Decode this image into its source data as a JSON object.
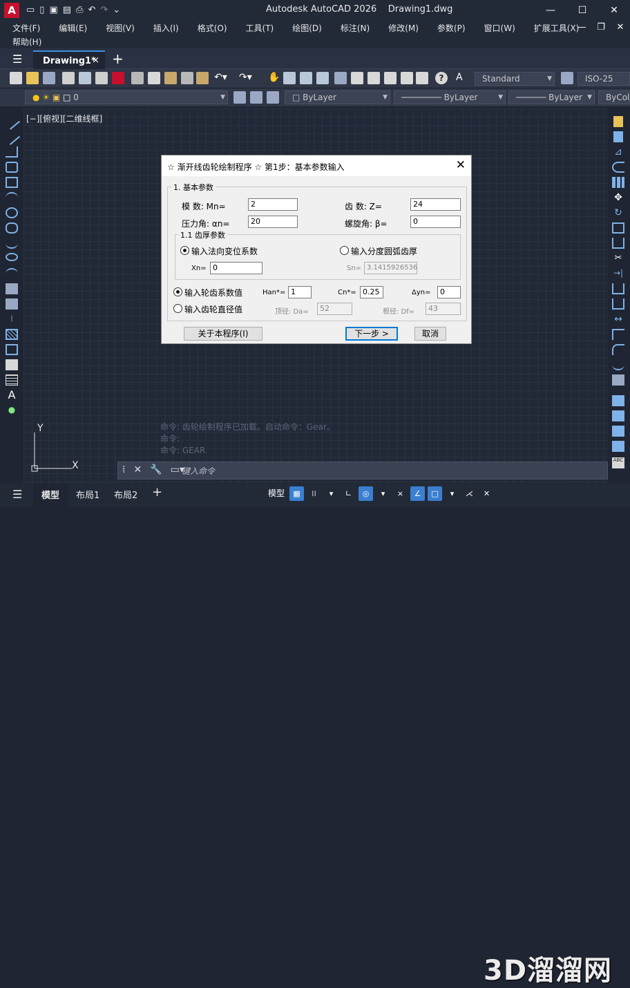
{
  "app": {
    "logo": "A",
    "title": "Autodesk AutoCAD 2026",
    "document": "Drawing1.dwg"
  },
  "menu": [
    "文件(F)",
    "编辑(E)",
    "视图(V)",
    "插入(I)",
    "格式(O)",
    "工具(T)",
    "绘图(D)",
    "标注(N)",
    "修改(M)",
    "参数(P)",
    "窗口(W)",
    "扩展工具(X)"
  ],
  "menu_help": "帮助(H)",
  "tab": {
    "label": "Drawing1*",
    "close": "×",
    "new": "+"
  },
  "toolbar": {
    "text_style": "Standard",
    "dim_style": "ISO-25",
    "layer": "0",
    "color": "ByLayer",
    "linetype": "ByLayer",
    "lineweight": "ByLayer",
    "plotstyle": "ByCol"
  },
  "viewport_label": "[−][俯视][二维线框]",
  "ucs": {
    "x": "X",
    "y": "Y"
  },
  "command": {
    "history": [
      "命令: 齿轮绘制程序已加载。启动命令：Gear。",
      "命令:",
      "命令: GEAR"
    ],
    "placeholder": "键入命令"
  },
  "status": {
    "tabs": [
      "模型",
      "布局1",
      "布局2"
    ],
    "model": "模型"
  },
  "watermark": "3D溜溜网",
  "dialog": {
    "title": "☆ 渐开线齿轮绘制程序 ☆ 第1步：基本参数输入",
    "section1": "1. 基本参数",
    "mn_label": "模  数:  Mn=",
    "mn_value": "2",
    "z_label": "齿  数:  Z=",
    "z_value": "24",
    "alpha_label": "压力角: αn=",
    "alpha_value": "20",
    "beta_label": "螺旋角: β=",
    "beta_value": "0",
    "section11": "1.1 齿厚参数",
    "radio_xn": "输入法向变位系数",
    "radio_sn": "输入分度圆弧齿厚",
    "xn_label": "Xn=",
    "xn_value": "0",
    "sn_label": "Sn=",
    "sn_value": "3.1415926536",
    "radio_coef": "输入轮齿系数值",
    "han_label": "Han*=",
    "han_value": "1",
    "cn_label": "Cn*=",
    "cn_value": "0.25",
    "dyn_label": "Δyn=",
    "dyn_value": "0",
    "radio_dia": "输入齿轮直径值",
    "da_label": "顶径: Da=",
    "da_value": "52",
    "df_label": "根径: Df=",
    "df_value": "43",
    "about_button": "关于本程序(I)",
    "next_button": "下一步 >",
    "cancel_button": "取消"
  }
}
